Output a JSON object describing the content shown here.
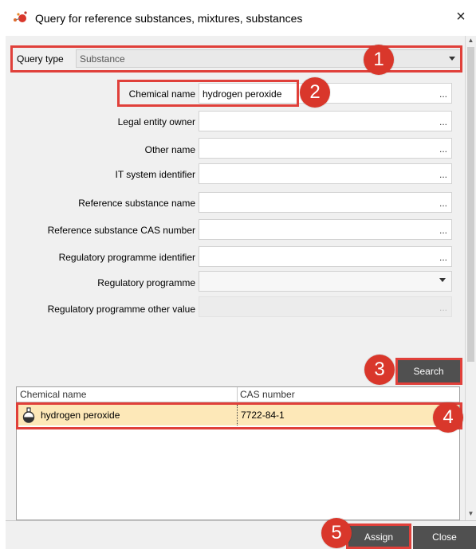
{
  "window": {
    "title": "Query for reference substances, mixtures, substances",
    "close_icon": "×"
  },
  "query_type": {
    "label": "Query type",
    "value": "Substance"
  },
  "fields": [
    {
      "label": "Chemical name",
      "value": "hydrogen peroxide",
      "kind": "text"
    },
    {
      "label": "Legal entity owner",
      "value": "",
      "kind": "text"
    },
    {
      "label": "Other name",
      "value": "",
      "kind": "text"
    },
    {
      "label": "IT system identifier",
      "value": "",
      "kind": "text"
    },
    {
      "label": "Reference substance name",
      "value": "",
      "kind": "text"
    },
    {
      "label": "Reference substance CAS number",
      "value": "",
      "kind": "text"
    },
    {
      "label": "Regulatory programme identifier",
      "value": "",
      "kind": "text"
    },
    {
      "label": "Regulatory programme",
      "value": "",
      "kind": "select"
    },
    {
      "label": "Regulatory programme other value",
      "value": "",
      "kind": "disabled"
    }
  ],
  "ellipsis": "...",
  "buttons": {
    "search": "Search",
    "assign": "Assign",
    "close": "Close"
  },
  "results": {
    "columns": [
      "Chemical name",
      "CAS number"
    ],
    "rows": [
      {
        "name": "hydrogen peroxide",
        "cas": "7722-84-1",
        "icon": "flask-icon"
      }
    ]
  },
  "badges": [
    "1",
    "2",
    "3",
    "4",
    "5"
  ],
  "colors": {
    "highlight": "#e0403a",
    "badge": "#d9372b",
    "selected_row": "#fde8b8",
    "button": "#505050"
  }
}
